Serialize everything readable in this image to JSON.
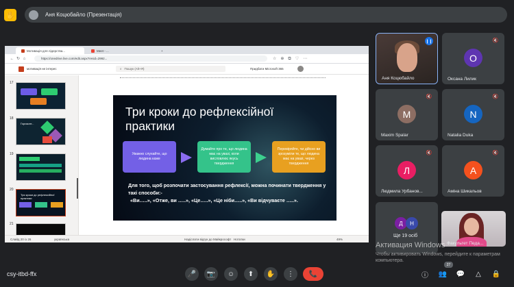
{
  "topbar": {
    "logo": "✋",
    "presenter": "Аня Коцюбайло (Презентація)"
  },
  "browser": {
    "tab1": "Мотивація для лідерства...",
    "tab2": "Meet - ...",
    "url": "https://onedrive.live.com/edit.aspx?resid=2992...",
    "add_tab": "+"
  },
  "ppt": {
    "doc_name": "мотивація не інтерес",
    "search_placeholder": "Пошук (Alt+Я)",
    "buy": "Придбати Microsoft 365",
    "status_slide": "Слайд 20 із 26",
    "status_lang": "українська",
    "status_feedback": "Надіслати відгук до Майкрософт",
    "status_notes": "Нотатки",
    "status_zoom": "49%"
  },
  "thumbs": [
    {
      "num": "17",
      "title": ""
    },
    {
      "num": "18",
      "title": "Горизонт..."
    },
    {
      "num": "19",
      "title": ""
    },
    {
      "num": "20",
      "title": "Три кроки до рефлексійної практики"
    },
    {
      "num": "21",
      "title": ""
    }
  ],
  "slide": {
    "title": "Три кроки до рефлексійної практики",
    "box1": "Уважно слухайте, що людина каже",
    "box2": "Думайте про те, що людина має на увазі, коли висловлює якусь твердження",
    "box3": "Перевіряйте, чи дійсно ви зрозуміли те, що людина має на увазі, через твердження",
    "body_line1": "Для того, щоб розпочати застосування рефлексії, можна починати твердження у такі способи:-",
    "body_line2": "«Ви…..», «Отже, ви …..», «Це…..», «Це ніби…..», «Ви відчуваєте …..»."
  },
  "participants": [
    {
      "name": "Аня Коцюбайло",
      "initial": "",
      "color": ""
    },
    {
      "name": "Оксана Лилик",
      "initial": "О",
      "color": "#5e35b1"
    },
    {
      "name": "Maxim Spalar",
      "initial": "M",
      "color": "#8d6e63"
    },
    {
      "name": "Natalia Duka",
      "initial": "N",
      "color": "#1565c0"
    },
    {
      "name": "Людмила Урбанов...",
      "initial": "Л",
      "color": "#e91e63"
    },
    {
      "name": "Аміна Шикальов",
      "initial": "А",
      "color": "#f4511e"
    }
  ],
  "others": {
    "a1": "Д",
    "a2": "Н",
    "count": "Ще 19 осіб"
  },
  "self": {
    "name": "Факультет Педа..."
  },
  "watermark": {
    "line1": "Активация Windows",
    "line2": "Чтобы активировать Windows, перейдите к параметрам компьютера."
  },
  "bottom": {
    "meeting_code": "csy-itbd-ffx",
    "people_count": "27"
  },
  "icons": {
    "mic": "🎤",
    "mic_off": "🔇",
    "cam": "📷",
    "emoji": "☺",
    "present": "⬆",
    "hand": "✋",
    "more": "⋮",
    "end": "📞",
    "info": "ⓘ",
    "people": "👥",
    "chat": "💬",
    "activities": "△",
    "lock": "🔒"
  },
  "colors": {
    "accent": "#8ab4f8",
    "end_call": "#ea4335",
    "ppt_brand": "#c43e1c"
  }
}
